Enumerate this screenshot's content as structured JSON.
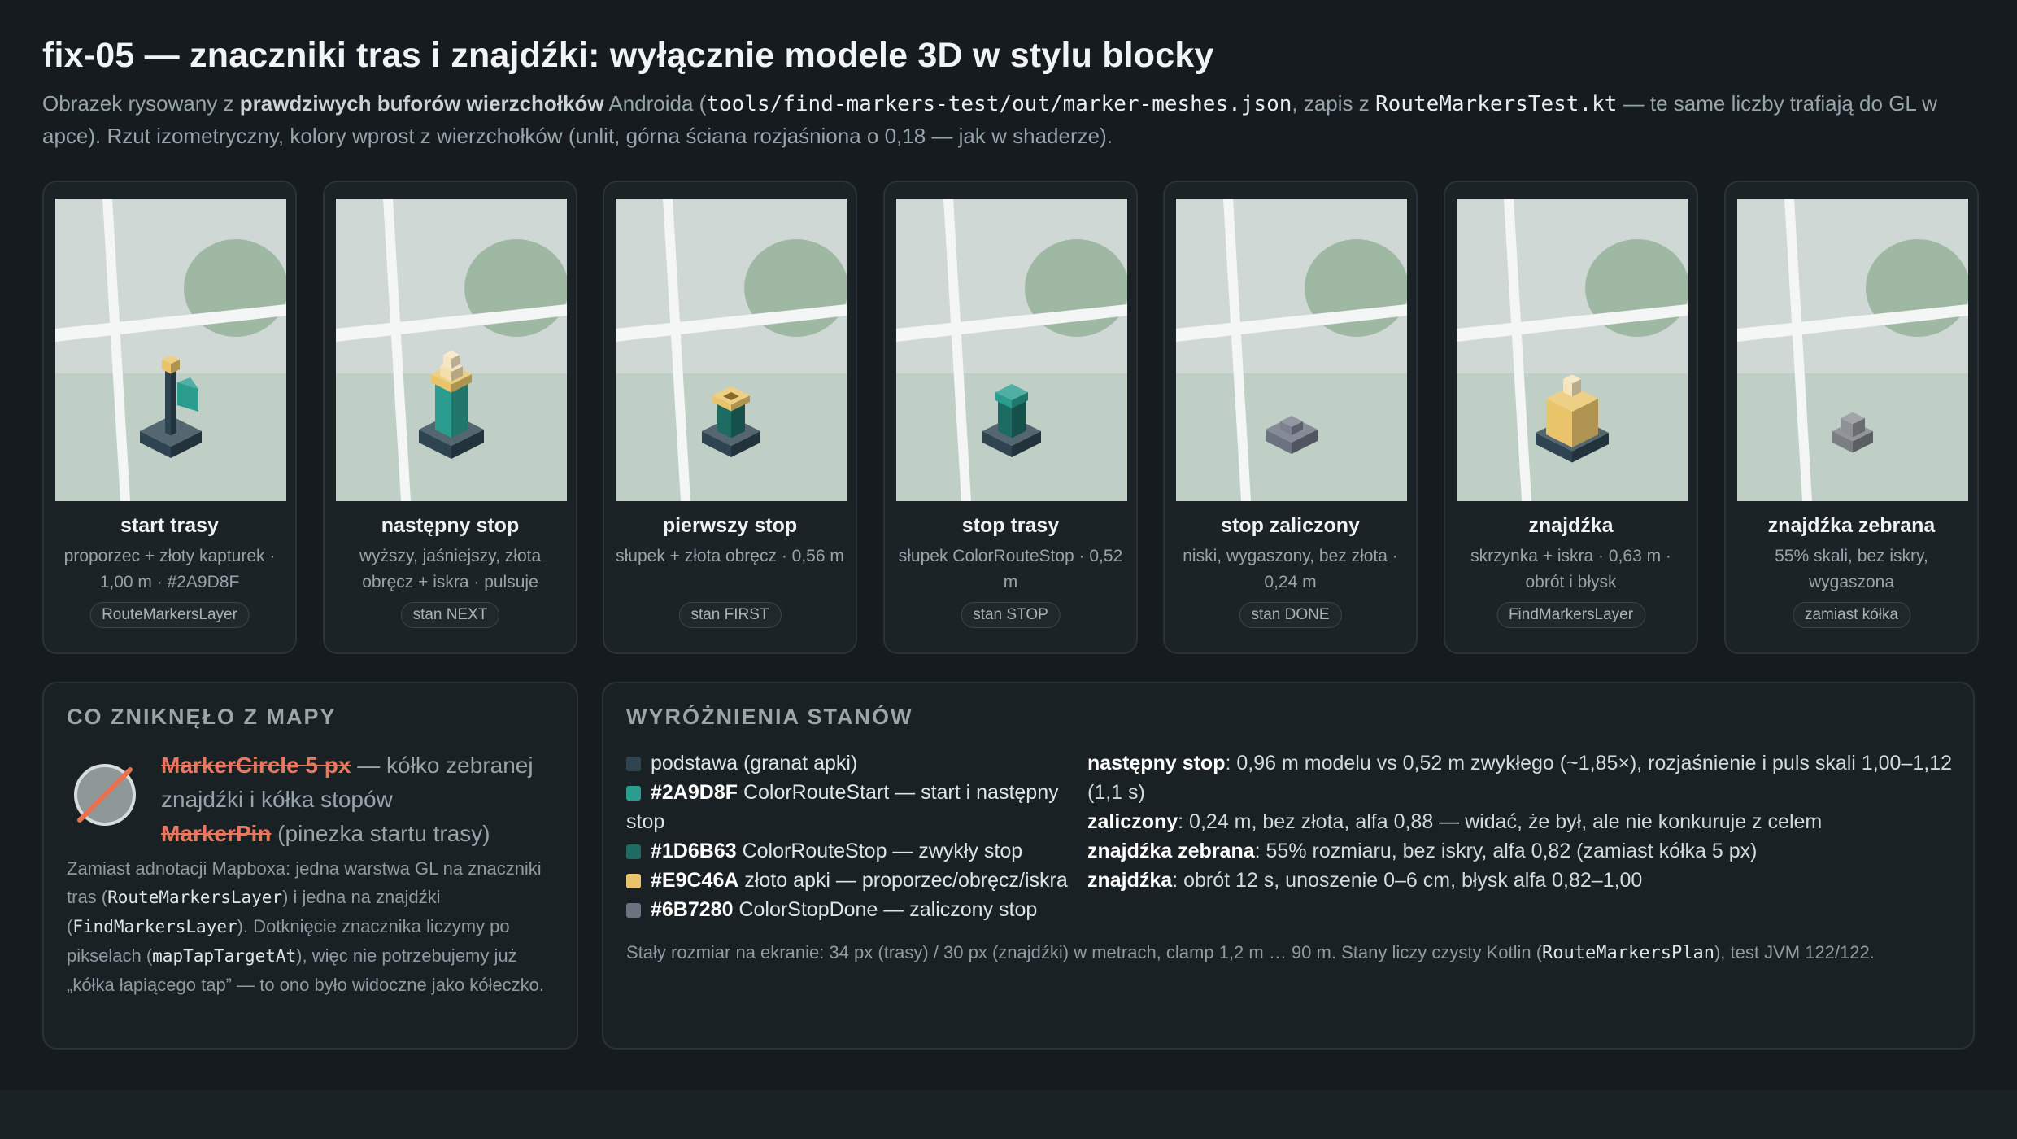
{
  "header": {
    "title": "fix-05 — znaczniki tras i znajdźki: wyłącznie modele 3D w stylu blocky",
    "lead_1": "Obrazek rysowany z ",
    "lead_bold": "prawdziwych buforów wierzchołków",
    "lead_2": " Androida (",
    "lead_code_1": "tools/find-markers-test/out/marker-meshes.json",
    "lead_3": ", zapis z ",
    "lead_code_2": "RouteMarkersTest.kt",
    "lead_4": " — te same liczby trafiają do GL w apce). Rzut izometryczny, kolory wprost z wierzchołków (unlit, górna ściana rozjaśniona o 0,18 — jak w shaderze)."
  },
  "cards": [
    {
      "name": "start trasy",
      "desc": "proporzec + złoty kapturek · 1,00 m · #2A9D8F",
      "tag": "RouteMarkersLayer",
      "model": "flag"
    },
    {
      "name": "następny stop",
      "desc": "wyższy, jaśniejszy, złota obręcz + iskra · pulsuje",
      "tag": "stan NEXT",
      "model": "next"
    },
    {
      "name": "pierwszy stop",
      "desc": "słupek + złota obręcz · 0,56 m",
      "tag": "stan FIRST",
      "model": "first"
    },
    {
      "name": "stop trasy",
      "desc": "słupek ColorRouteStop · 0,52 m",
      "tag": "stan STOP",
      "model": "stop"
    },
    {
      "name": "stop zaliczony",
      "desc": "niski, wygaszony, bez złota · 0,24 m",
      "tag": "stan DONE",
      "model": "done"
    },
    {
      "name": "znajdźka",
      "desc": "skrzynka + iskra · 0,63 m · obrót i błysk",
      "tag": "FindMarkersLayer",
      "model": "find"
    },
    {
      "name": "znajdźka zebrana",
      "desc": "55% skali, bez iskry, wygaszona",
      "tag": "zamiast kółka",
      "model": "collected"
    }
  ],
  "gone": {
    "title": "CO ZNIKNĘŁO Z MAPY",
    "item1_strike": "MarkerCircle 5 px",
    "item1_rest": " — kółko zebranej znajdźki i kółka stopów",
    "item2_strike": "MarkerPin",
    "item2_rest": " (pinezka startu trasy)",
    "note_1": "Zamiast adnotacji Mapboxa: jedna warstwa GL na znaczniki tras (",
    "note_code_1": "RouteMarkersLayer",
    "note_2": ") i jedna na znajdźki (",
    "note_code_2": "FindMarkersLayer",
    "note_3": "). Dotknięcie znacznika liczymy po pikselach (",
    "note_code_3": "mapTapTargetAt",
    "note_4": "), więc nie potrzebujemy już „kółka łapiącego tap” — to ono było widoczne jako kółeczko."
  },
  "states": {
    "title": "WYRÓŻNIENIA STANÓW",
    "legend": [
      {
        "color": "#2e4450",
        "code": "",
        "text": "podstawa (granat apki)"
      },
      {
        "color": "#2A9D8F",
        "code": "#2A9D8F",
        "text": " ColorRouteStart — start i następny stop"
      },
      {
        "color": "#1D6B63",
        "code": "#1D6B63",
        "text": " ColorRouteStop — zwykły stop"
      },
      {
        "color": "#E9C46A",
        "code": "#E9C46A",
        "text": " złoto apki — proporzec/obręcz/iskra"
      },
      {
        "color": "#6B7280",
        "code": "#6B7280",
        "text": " ColorStopDone — zaliczony stop"
      }
    ],
    "highlights": [
      {
        "label": "następny stop",
        "text": ": 0,96 m modelu vs 0,52 m zwykłego (~1,85×), rozjaśnienie i puls skali 1,00–1,12 (1,1 s)"
      },
      {
        "label": "zaliczony",
        "text": ": 0,24 m, bez złota, alfa 0,88 — widać, że był, ale nie konkuruje z celem"
      },
      {
        "label": "znajdźka zebrana",
        "text": ": 55% rozmiaru, bez iskry, alfa 0,82 (zamiast kółka 5 px)"
      },
      {
        "label": "znajdźka",
        "text": ": obrót 12 s, unoszenie 0–6 cm, błysk alfa 0,82–1,00"
      }
    ],
    "footer_1": "Stały rozmiar na ekranie: 34 px (trasy) / 30 px (znajdźki) w metrach, clamp 1,2 m … 90 m. Stany liczy czysty Kotlin (",
    "footer_code": "RouteMarkersPlan",
    "footer_2": "), test JVM 122/122."
  },
  "colors": {
    "base_navy": "#2e4450",
    "route_start": "#2A9D8F",
    "route_stop": "#1D6B63",
    "gold": "#E9C46A",
    "stop_done": "#6B7280",
    "strike_red": "#e87862"
  }
}
